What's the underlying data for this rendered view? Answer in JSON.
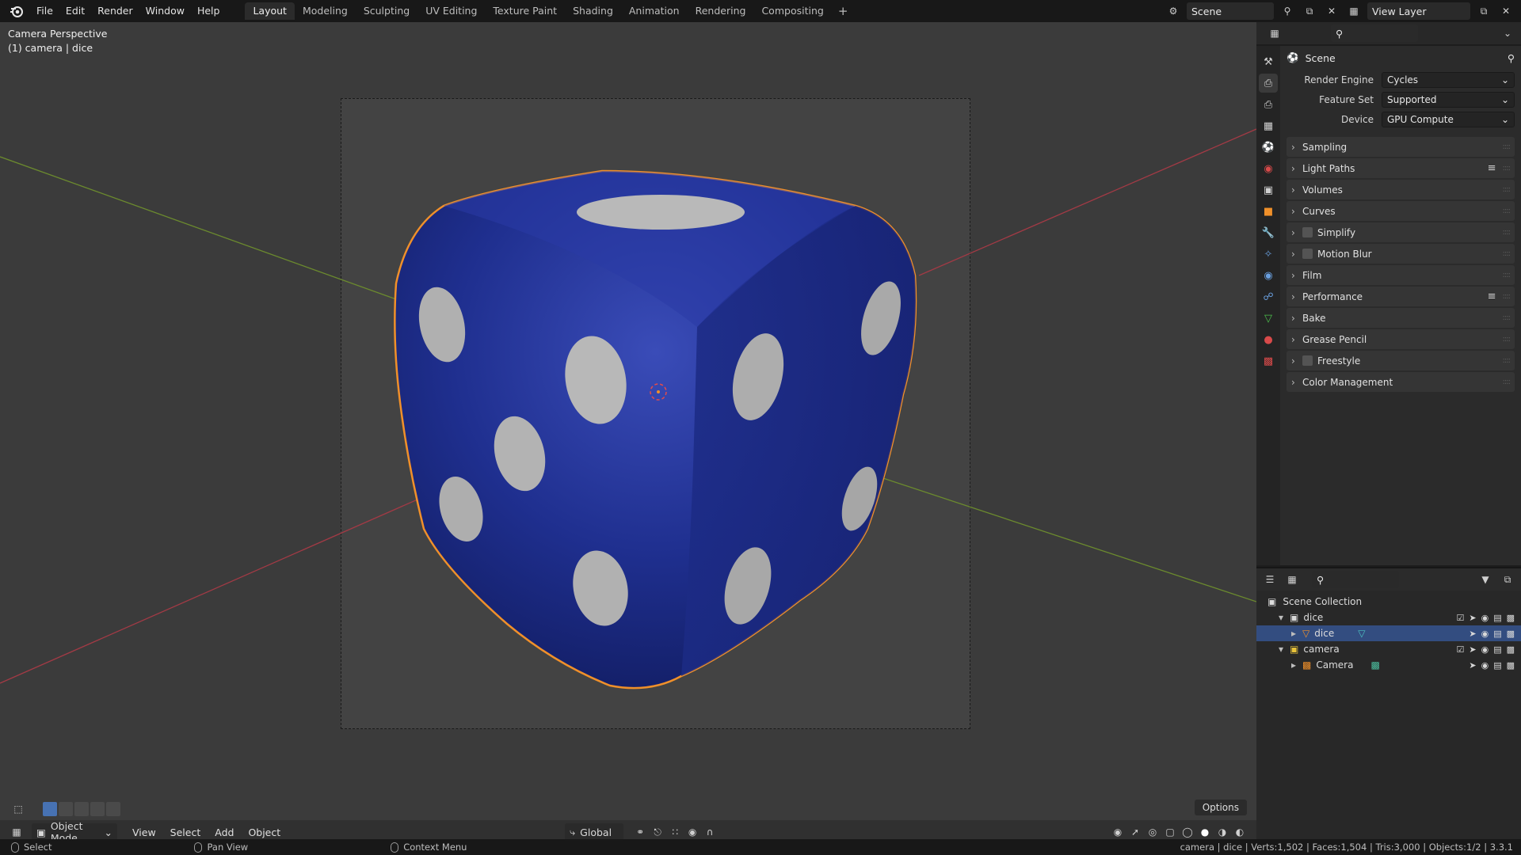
{
  "menu": [
    "File",
    "Edit",
    "Render",
    "Window",
    "Help"
  ],
  "workspaces": [
    "Layout",
    "Modeling",
    "Sculpting",
    "UV Editing",
    "Texture Paint",
    "Shading",
    "Animation",
    "Rendering",
    "Compositing"
  ],
  "workspace_add": "+",
  "scene_name": "Scene",
  "view_layer": "View Layer",
  "viewport": {
    "perspective_label": "Camera Perspective",
    "object_label": "(1) camera | dice",
    "mode": "Object Mode",
    "header_menus": [
      "View",
      "Select",
      "Add",
      "Object"
    ],
    "orientation": "Global",
    "options": "Options"
  },
  "properties": {
    "context_title": "Scene",
    "render_engine_label": "Render Engine",
    "render_engine": "Cycles",
    "feature_set_label": "Feature Set",
    "feature_set": "Supported",
    "device_label": "Device",
    "device": "GPU Compute",
    "panels": [
      {
        "label": "Sampling"
      },
      {
        "label": "Light Paths"
      },
      {
        "label": "Volumes"
      },
      {
        "label": "Curves"
      },
      {
        "label": "Simplify"
      },
      {
        "label": "Motion Blur"
      },
      {
        "label": "Film"
      },
      {
        "label": "Performance"
      },
      {
        "label": "Bake"
      },
      {
        "label": "Grease Pencil"
      },
      {
        "label": "Freestyle"
      },
      {
        "label": "Color Management"
      }
    ]
  },
  "outliner": {
    "root": "Scene Collection",
    "rows": [
      "dice",
      "dice",
      "camera",
      "Camera"
    ]
  },
  "status": {
    "select": "Select",
    "pan": "Pan View",
    "context": "Context Menu",
    "stats": "camera | dice | Verts:1,502 | Faces:1,504 | Tris:3,000 | Objects:1/2 | 3.3.1"
  },
  "colors": {
    "accent": "#4772b3",
    "selection_outline": "#f0902a",
    "dice_body": "#1f2f8f",
    "pips": "#b8b8b8"
  }
}
